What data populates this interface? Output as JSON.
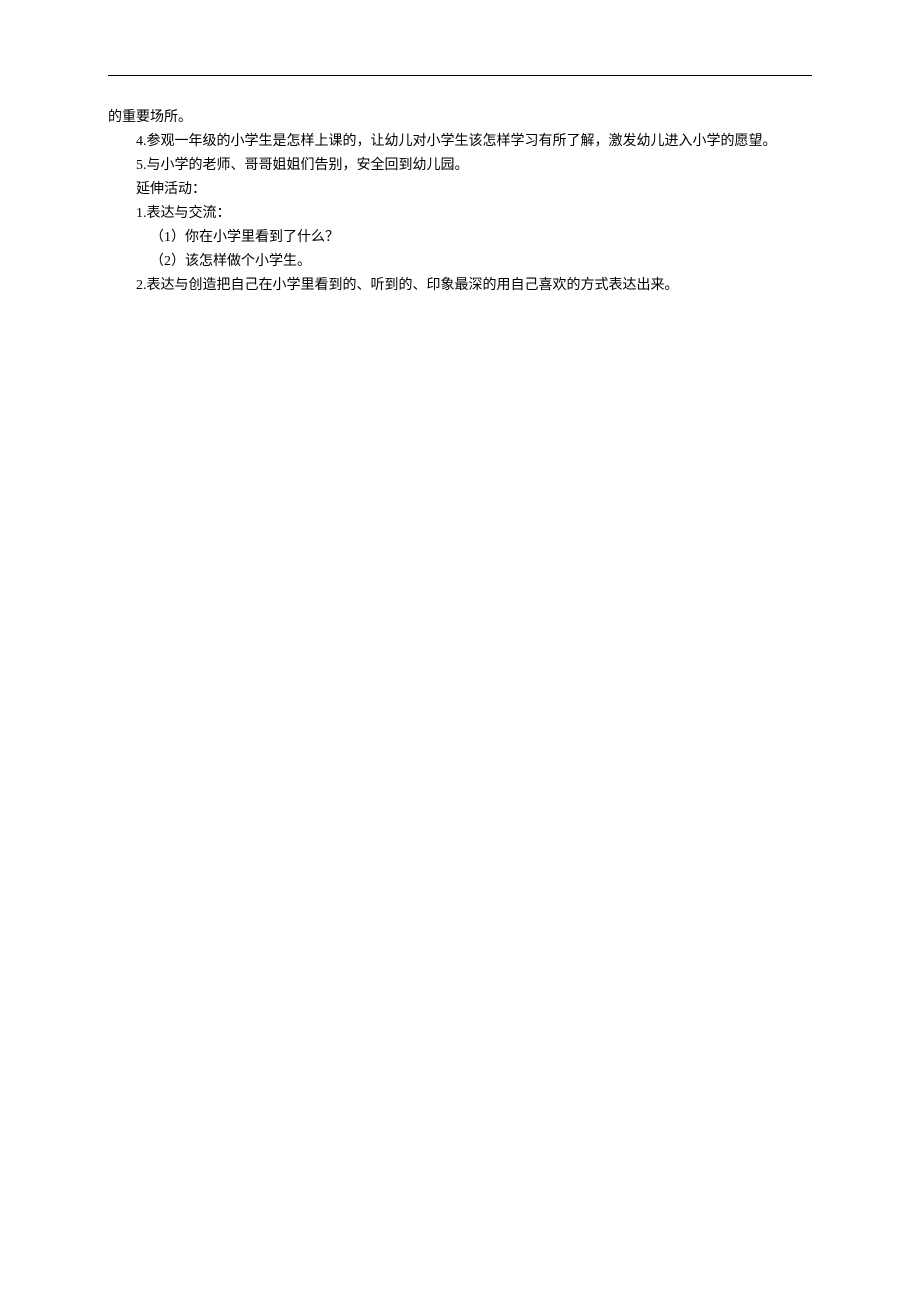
{
  "content": {
    "lines": [
      {
        "text": "的重要场所。",
        "indent": 0
      },
      {
        "text": "4.参观一年级的小学生是怎样上课的，让幼儿对小学生该怎样学习有所了解，激发幼儿进入小学的愿望。",
        "indent": 1
      },
      {
        "text": "5.与小学的老师、哥哥姐姐们告别，安全回到幼儿园。",
        "indent": 1
      },
      {
        "text": "延伸活动：",
        "indent": 1
      },
      {
        "text": "1.表达与交流：",
        "indent": 1
      },
      {
        "text": "（1）你在小学里看到了什么？",
        "indent": 2
      },
      {
        "text": "（2）该怎样做个小学生。",
        "indent": 2
      },
      {
        "text": "2.表达与创造把自己在小学里看到的、听到的、印象最深的用自己喜欢的方式表达出来。",
        "indent": 1
      }
    ]
  }
}
